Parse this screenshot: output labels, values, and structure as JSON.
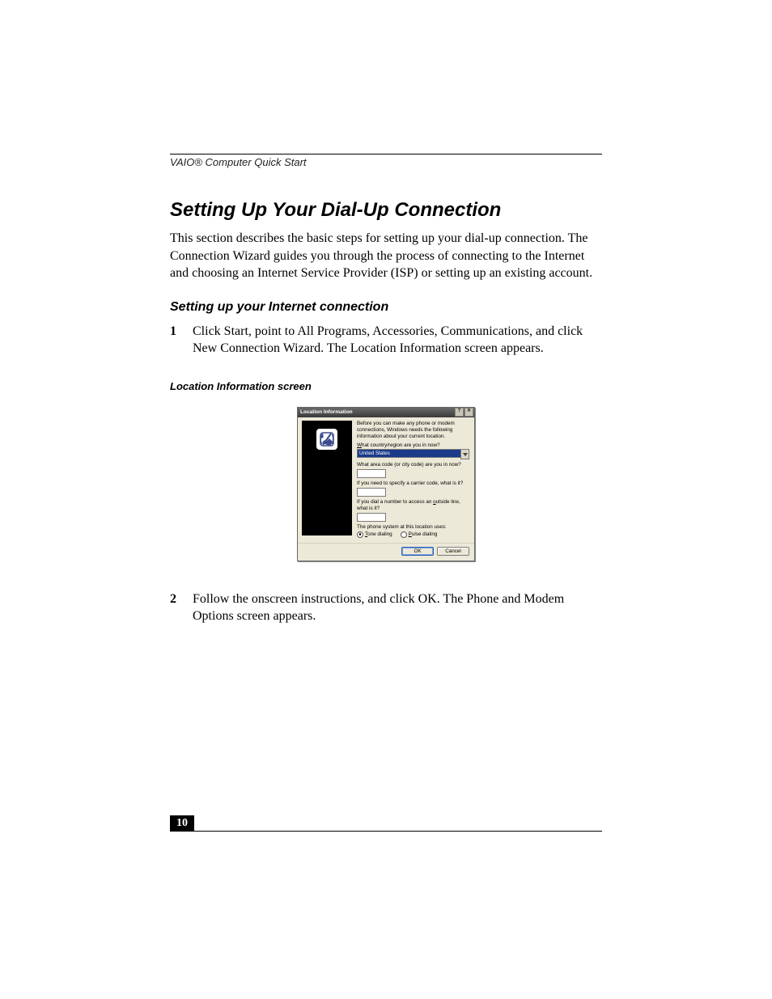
{
  "running_head": "VAIO® Computer Quick Start",
  "title": "Setting Up Your Dial-Up Connection",
  "intro": "This section describes the basic steps for setting up your dial-up connection. The Connection Wizard guides you through the process of connecting to the Internet and choosing an Internet Service Provider (ISP) or setting up an existing account.",
  "subhead": "Setting up your Internet connection",
  "steps": {
    "s1_num": "1",
    "s1_text": "Click Start, point to All Programs, Accessories, Communications, and click New Connection Wizard. The Location Information screen appears.",
    "s2_num": "2",
    "s2_text": "Follow the onscreen instructions, and click OK. The Phone and Modem Options screen appears."
  },
  "figure_caption": "Location Information screen",
  "dialog": {
    "title": "Location Information",
    "help_glyph": "?",
    "close_glyph": "✕",
    "intro": "Before you can make any phone or modem connections, Windows needs the following information about your current location.",
    "q_country_pre": "W",
    "q_country_rest": "hat country/region are you in now?",
    "country_value": "United States",
    "q_areacode": "What area code (or city code) are you in now?",
    "q_carrier": "If you need to specify a carrier code, what is it?",
    "q_outside_pre": "If you dial a number to access an ",
    "q_outside_u": "o",
    "q_outside_rest": "utside line, what is it?",
    "q_phonesys": "The phone system at this location uses:",
    "radio_tone_u": "T",
    "radio_tone_rest": "one dialing",
    "radio_pulse_u": "P",
    "radio_pulse_rest": "ulse dialing",
    "ok": "OK",
    "cancel": "Cancel"
  },
  "page_number": "10"
}
